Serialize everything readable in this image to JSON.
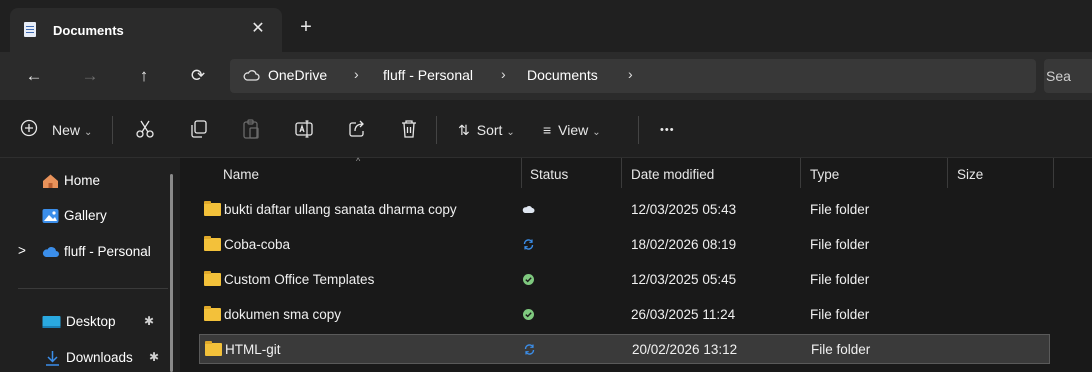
{
  "window": {
    "tab_title": "Documents",
    "close_glyph": "✕",
    "add_glyph": "+"
  },
  "nav": {
    "back_glyph": "←",
    "forward_glyph": "→",
    "up_glyph": "↑",
    "refresh_glyph": "⟳",
    "breadcrumb": [
      "OneDrive",
      "fluff - Personal",
      "Documents"
    ],
    "separator": "›",
    "search_placeholder": "Sea"
  },
  "toolbar": {
    "new_label": "New",
    "sort_label": "Sort",
    "view_label": "View",
    "more_label": "•••",
    "icons": [
      "cut-icon",
      "copy-icon",
      "paste-icon",
      "rename-icon",
      "share-icon",
      "delete-icon"
    ]
  },
  "sidebar": {
    "items": [
      {
        "label": "Home",
        "icon": "home-icon"
      },
      {
        "label": "Gallery",
        "icon": "gallery-icon"
      },
      {
        "label": "fluff - Personal",
        "icon": "onedrive-icon"
      },
      {
        "label": "Desktop",
        "icon": "desktop-icon"
      },
      {
        "label": "Downloads",
        "icon": "downloads-icon"
      }
    ],
    "expand_glyph": ">",
    "pin_glyph": "📌"
  },
  "columns": [
    "Name",
    "Status",
    "Date modified",
    "Type",
    "Size"
  ],
  "files": [
    {
      "name": "bukti daftar ullang sanata dharma copy",
      "status": "cloud",
      "date": "12/03/2025 05:43",
      "type": "File folder",
      "size": ""
    },
    {
      "name": "Coba-coba",
      "status": "syncing",
      "date": "18/02/2026 08:19",
      "type": "File folder",
      "size": ""
    },
    {
      "name": "Custom Office Templates",
      "status": "available",
      "date": "12/03/2025 05:45",
      "type": "File folder",
      "size": ""
    },
    {
      "name": "dokumen sma copy",
      "status": "available",
      "date": "26/03/2025 11:24",
      "type": "File folder",
      "size": ""
    },
    {
      "name": "HTML-git",
      "status": "syncing",
      "date": "20/02/2026 13:12",
      "type": "File folder",
      "size": ""
    }
  ],
  "colors": {
    "folder": "#f3c13a",
    "cloud_status": "#dfe6f0",
    "sync_status": "#3b8eea",
    "available_status": "#7fc97f"
  }
}
